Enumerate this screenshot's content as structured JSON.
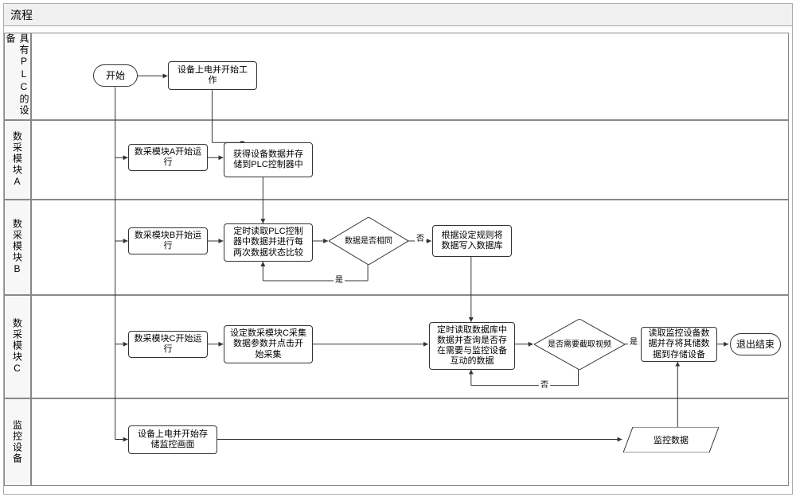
{
  "title": "流程",
  "lanes": {
    "l1": "具有PLC的设备",
    "l2": "数采模块A",
    "l3": "数采模块B",
    "l4": "数采模块C",
    "l5": "监控设备"
  },
  "nodes": {
    "start": "开始",
    "n1": "设备上电并开始工作",
    "n2": "数采模块A开始运行",
    "n3": "获得设备数据并存储到PLC控制器中",
    "n4": "数采模块B开始运行",
    "n5": "定时读取PLC控制器中数据并进行每两次数据状态比较",
    "d1": "数据是否相同",
    "n6": "根据设定规则将数据写入数据库",
    "n7": "数采模块C开始运行",
    "n8": "设定数采模块C采集数据参数并点击开始采集",
    "n9": "定时读取数据库中数据并查询是否存在需要与监控设备互动的数据",
    "d2": "是否需要截取视频",
    "n10": "读取监控设备数据并存将其储数据到存储设备",
    "end": "退出结束",
    "n11": "设备上电并开始存储监控画面",
    "n12": "监控数据"
  },
  "edgeLabels": {
    "yes": "是",
    "no": "否"
  }
}
